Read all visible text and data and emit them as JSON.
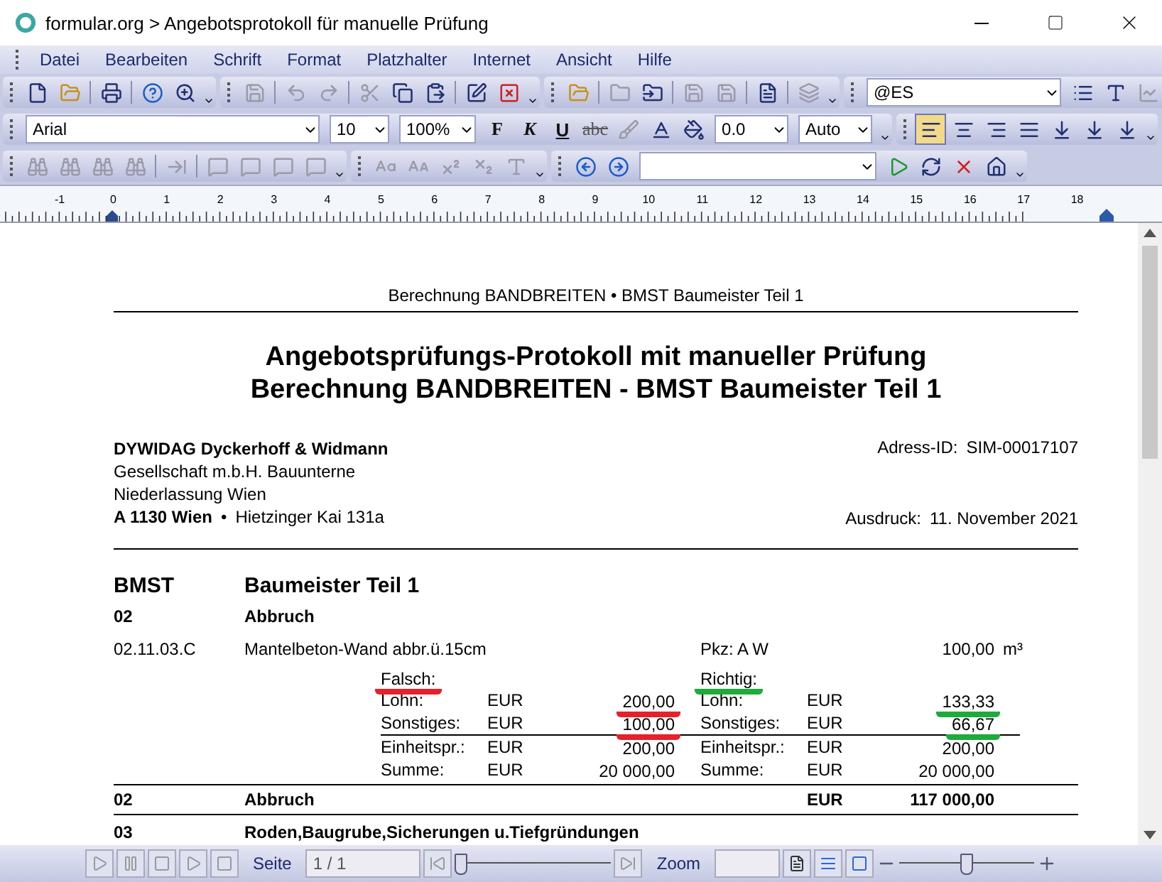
{
  "window": {
    "title": "formular.org > Angebotsprotokoll für manuelle Prüfung"
  },
  "menu": [
    {
      "label": "Datei"
    },
    {
      "label": "Bearbeiten"
    },
    {
      "label": "Schrift"
    },
    {
      "label": "Format"
    },
    {
      "label": "Platzhalter"
    },
    {
      "label": "Internet"
    },
    {
      "label": "Ansicht"
    },
    {
      "label": "Hilfe"
    }
  ],
  "toolbar_rows": [
    [
      {
        "items": [
          {
            "kind": "new",
            "disabled": false
          },
          {
            "kind": "open",
            "disabled": false
          },
          {
            "kind": "sep"
          },
          {
            "kind": "print",
            "disabled": false
          },
          {
            "kind": "sep"
          },
          {
            "kind": "help",
            "disabled": false
          },
          {
            "kind": "preview",
            "disabled": false
          }
        ]
      },
      {
        "items": [
          {
            "kind": "save",
            "disabled": true
          },
          {
            "kind": "sep"
          },
          {
            "kind": "undo",
            "disabled": true
          },
          {
            "kind": "redo",
            "disabled": true
          },
          {
            "kind": "sep"
          },
          {
            "kind": "cut",
            "disabled": true
          },
          {
            "kind": "copy",
            "disabled": false
          },
          {
            "kind": "paste",
            "disabled": false
          },
          {
            "kind": "sep"
          },
          {
            "kind": "edit",
            "disabled": false
          },
          {
            "kind": "delete",
            "disabled": false
          }
        ]
      },
      {
        "items": [
          {
            "kind": "open",
            "disabled": false
          },
          {
            "kind": "sep"
          },
          {
            "kind": "folder",
            "disabled": true
          },
          {
            "kind": "export",
            "disabled": false
          },
          {
            "kind": "sep"
          },
          {
            "kind": "save",
            "disabled": true
          },
          {
            "kind": "save",
            "disabled": true
          },
          {
            "kind": "sep"
          },
          {
            "kind": "page",
            "disabled": false
          },
          {
            "kind": "sep"
          },
          {
            "kind": "layers",
            "disabled": true
          }
        ]
      },
      {
        "items": [
          {
            "kind": "style-combo",
            "value": "@ES"
          },
          {
            "kind": "list",
            "disabled": false
          },
          {
            "kind": "text-frame",
            "disabled": false
          },
          {
            "kind": "chart",
            "disabled": true
          }
        ]
      }
    ],
    [
      {
        "items": [
          {
            "kind": "font-combo",
            "value": "Arial"
          },
          {
            "kind": "size-combo",
            "value": "10"
          },
          {
            "kind": "zoom-combo",
            "value": "100%"
          },
          {
            "kind": "bold",
            "label": "F"
          },
          {
            "kind": "italic",
            "label": "K"
          },
          {
            "kind": "underline",
            "label": "U"
          },
          {
            "kind": "strike",
            "label": "abc"
          },
          {
            "kind": "brush",
            "disabled": true
          },
          {
            "kind": "font-color",
            "disabled": false
          },
          {
            "kind": "fill-color",
            "disabled": false
          },
          {
            "kind": "number-combo",
            "value": "0.0"
          },
          {
            "kind": "number-combo",
            "value": "Auto"
          }
        ]
      },
      {
        "items": [
          {
            "kind": "align-left",
            "disabled": false,
            "selected": true
          },
          {
            "kind": "align-center",
            "disabled": false,
            "selected": false
          },
          {
            "kind": "align-right",
            "disabled": false,
            "selected": false
          },
          {
            "kind": "align-justify",
            "disabled": false,
            "selected": false
          },
          {
            "kind": "tab-stop",
            "disabled": false
          },
          {
            "kind": "tab-stop",
            "disabled": false
          },
          {
            "kind": "tab-stop",
            "disabled": false
          }
        ]
      }
    ],
    [
      {
        "items": [
          {
            "kind": "find",
            "disabled": true
          },
          {
            "kind": "find",
            "disabled": true
          },
          {
            "kind": "find",
            "disabled": true
          },
          {
            "kind": "find",
            "disabled": true
          },
          {
            "kind": "sep"
          },
          {
            "kind": "goto",
            "disabled": true
          },
          {
            "kind": "sep"
          },
          {
            "kind": "comment",
            "disabled": true
          },
          {
            "kind": "comment",
            "disabled": true
          },
          {
            "kind": "comment",
            "disabled": true
          },
          {
            "kind": "comment",
            "disabled": true
          }
        ]
      },
      {
        "items": [
          {
            "kind": "case",
            "disabled": true
          },
          {
            "kind": "grow",
            "disabled": true
          },
          {
            "kind": "superscript",
            "disabled": true
          },
          {
            "kind": "subscript",
            "disabled": true
          },
          {
            "kind": "font-type",
            "disabled": true
          }
        ]
      },
      {
        "items": [
          {
            "kind": "back",
            "disabled": false
          },
          {
            "kind": "forward",
            "disabled": false
          },
          {
            "kind": "address-combo"
          },
          {
            "kind": "play",
            "disabled": false
          },
          {
            "kind": "sync",
            "disabled": false
          },
          {
            "kind": "stop",
            "disabled": false
          },
          {
            "kind": "home",
            "disabled": false
          }
        ]
      }
    ]
  ],
  "ruler": {
    "labels": [
      "-1",
      "0",
      "1",
      "2",
      "3",
      "4",
      "5",
      "6",
      "7",
      "8",
      "9",
      "10",
      "11",
      "12",
      "13",
      "14",
      "15",
      "16",
      "17",
      "18"
    ]
  },
  "document": {
    "running_header": "Berechnung BANDBREITEN • BMST Baumeister Teil 1",
    "title_lines": [
      "Angebotsprüfungs-Protokoll mit manueller Prüfung",
      "Berechnung BANDBREITEN - BMST Baumeister Teil 1"
    ],
    "company": {
      "name": "DYWIDAG Dyckerhoff & Widmann",
      "line_2": "Gesellschaft m.b.H. Bauunterne",
      "line_3": "Niederlassung Wien",
      "city": "A 1130 Wien",
      "separator": "•",
      "street": "Hietzinger Kai 131a"
    },
    "address_id": {
      "label": "Adress-ID:",
      "value": "SIM-00017107"
    },
    "print_date": {
      "label": "Ausdruck:",
      "value": "11. November 2021"
    },
    "section": {
      "code": "BMST",
      "title": "Baumeister Teil 1"
    },
    "group": {
      "code": "02",
      "title": "Abbruch"
    },
    "item": {
      "position": "02.11.03.C",
      "text": "Mantelbeton-Wand abbr.ü.15cm",
      "pkz": "Pkz: A  W",
      "quantity": "100,00",
      "unit": "m³"
    },
    "comparison": [
      {
        "heading": "Falsch:",
        "color": "#e8202a",
        "rows": [
          {
            "label": "Lohn:",
            "currency": "EUR",
            "value": "200,00",
            "underlined": true
          },
          {
            "label": "Sonstiges:",
            "currency": "EUR",
            "value": "100,00",
            "underlined": true
          },
          {
            "label": "Einheitspr.:",
            "currency": "EUR",
            "value": "200,00",
            "underlined": false
          },
          {
            "label": "Summe:",
            "currency": "EUR",
            "value": "20 000,00",
            "underlined": false
          }
        ]
      },
      {
        "heading": "Richtig:",
        "color": "#1faa3c",
        "rows": [
          {
            "label": "Lohn:",
            "currency": "EUR",
            "value": "133,33",
            "underlined": true
          },
          {
            "label": "Sonstiges:",
            "currency": "EUR",
            "value": "66,67",
            "underlined": true
          },
          {
            "label": "Einheitspr.:",
            "currency": "EUR",
            "value": "200,00",
            "underlined": false
          },
          {
            "label": "Summe:",
            "currency": "EUR",
            "value": "20 000,00",
            "underlined": false
          }
        ]
      }
    ],
    "group_total": {
      "code": "02",
      "title": "Abbruch",
      "currency": "EUR",
      "value": "117 000,00"
    },
    "next_group": {
      "code": "03",
      "title": "Roden,Baugrube,Sicherungen u.Tiefgründungen"
    }
  },
  "status_bar": {
    "page_label": "Seite",
    "page_value": "1 / 1",
    "page_slider": {
      "level": 0
    },
    "zoom_label": "Zoom",
    "zoom_slider": {
      "level": 0.5
    }
  }
}
